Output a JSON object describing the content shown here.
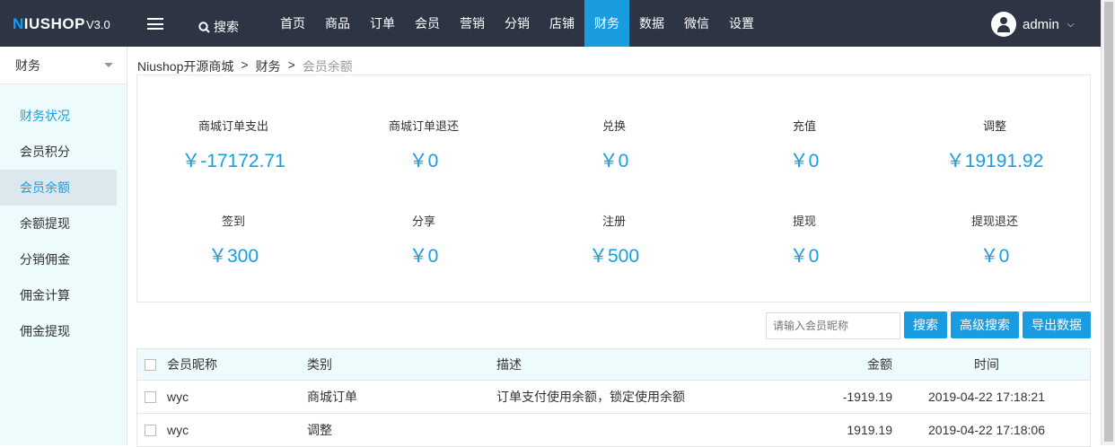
{
  "header": {
    "logo_main": "NIUSHOP",
    "logo_version": "V3.0",
    "search_label": "搜索",
    "nav": [
      {
        "label": "首页"
      },
      {
        "label": "商品"
      },
      {
        "label": "订单"
      },
      {
        "label": "会员"
      },
      {
        "label": "营销"
      },
      {
        "label": "分销"
      },
      {
        "label": "店铺"
      },
      {
        "label": "财务"
      },
      {
        "label": "数据"
      },
      {
        "label": "微信"
      },
      {
        "label": "设置"
      }
    ],
    "active_nav": "财务",
    "username": "admin"
  },
  "sidebar": {
    "title": "财务",
    "items": [
      {
        "label": "财务状况"
      },
      {
        "label": "会员积分"
      },
      {
        "label": "会员余额"
      },
      {
        "label": "余额提现"
      },
      {
        "label": "分销佣金"
      },
      {
        "label": "佣金计算"
      },
      {
        "label": "佣金提现"
      }
    ]
  },
  "breadcrumb": {
    "items": [
      "Niushop开源商城",
      "财务",
      "会员余额"
    ],
    "separator": ">"
  },
  "stats": [
    {
      "label": "商城订单支出",
      "value": "￥-17172.71"
    },
    {
      "label": "商城订单退还",
      "value": "￥0"
    },
    {
      "label": "兑换",
      "value": "￥0"
    },
    {
      "label": "充值",
      "value": "￥0"
    },
    {
      "label": "调整",
      "value": "￥19191.92"
    },
    {
      "label": "签到",
      "value": "￥300"
    },
    {
      "label": "分享",
      "value": "￥0"
    },
    {
      "label": "注册",
      "value": "￥500"
    },
    {
      "label": "提现",
      "value": "￥0"
    },
    {
      "label": "提现退还",
      "value": "￥0"
    }
  ],
  "toolbar": {
    "search_placeholder": "请输入会员昵称",
    "search_button": "搜索",
    "advanced_button": "高级搜索",
    "export_button": "导出数据"
  },
  "table": {
    "headers": {
      "name": "会员昵称",
      "type": "类别",
      "desc": "描述",
      "amount": "金额",
      "time": "时间"
    },
    "rows": [
      {
        "name": "wyc",
        "type": "商城订单",
        "desc": "订单支付使用余额，锁定使用余额",
        "amount": "-1919.19",
        "time": "2019-04-22 17:18:21"
      },
      {
        "name": "wyc",
        "type": "调整",
        "desc": "",
        "amount": "1919.19",
        "time": "2019-04-22 17:18:06"
      }
    ]
  },
  "colors": {
    "topbar": "#2d3544",
    "accent": "#1a9de0",
    "sidebar_bg": "#eefbfd"
  }
}
